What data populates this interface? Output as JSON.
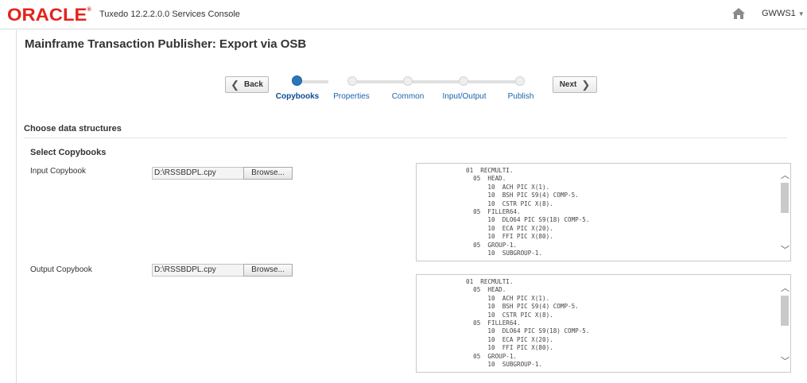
{
  "header": {
    "logo": "ORACLE",
    "logo_mark": "®",
    "app_title": "Tuxedo 12.2.2.0.0 Services Console",
    "user": "GWWS1",
    "home_icon": "home-icon",
    "user_caret": "▼"
  },
  "page": {
    "title": "Mainframe Transaction Publisher: Export via OSB"
  },
  "train": {
    "back_label": "Back",
    "next_label": "Next",
    "back_chevron": "❮",
    "next_chevron": "❯",
    "current_step": "Copybooks",
    "steps": [
      "Copybooks",
      "Properties",
      "Common",
      "Input/Output",
      "Publish"
    ]
  },
  "section": {
    "title": "Choose data structures",
    "subtitle": "Select Copybooks"
  },
  "input_copybook": {
    "label": "Input Copybook",
    "value": "D:\\RSSBDPL.cpy",
    "browse_label": "Browse...",
    "lines": [
      "01  RECMULTI.",
      "  05  HEAD.",
      "      10  ACH PIC X(1).",
      "      10  BSH PIC S9(4) COMP-5.",
      "      10  CSTR PIC X(8).",
      "  05  FILLER64.",
      "      10  DLO64 PIC S9(18) COMP-5.",
      "      10  ECA PIC X(20).",
      "      10  FFI PIC X(80).",
      "  05  GROUP-1.",
      "      10  SUBGROUP-1."
    ]
  },
  "output_copybook": {
    "label": "Output Copybook",
    "value": "D:\\RSSBDPL.cpy",
    "browse_label": "Browse...",
    "lines": [
      "01  RECMULTI.",
      "  05  HEAD.",
      "      10  ACH PIC X(1).",
      "      10  BSH PIC S9(4) COMP-5.",
      "      10  CSTR PIC X(8).",
      "  05  FILLER64.",
      "      10  DLO64 PIC S9(18) COMP-5.",
      "      10  ECA PIC X(20).",
      "      10  FFI PIC X(80).",
      "  05  GROUP-1.",
      "      10  SUBGROUP-1."
    ]
  },
  "scroll": {
    "up": "︿",
    "down": "﹀"
  },
  "colors": {
    "oracle_red": "#e4231c",
    "train_active": "#2a76bd",
    "link_blue": "#1a63b0"
  }
}
